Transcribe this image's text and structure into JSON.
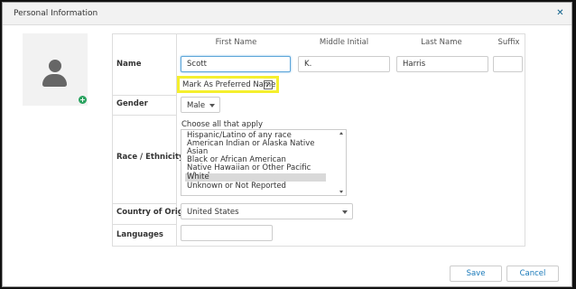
{
  "dialog": {
    "title": "Personal Information",
    "close_icon": "close-icon"
  },
  "avatar": {
    "icon": "user-silhouette-icon",
    "add_icon": "plus-icon"
  },
  "form": {
    "labels": {
      "name": "Name",
      "gender": "Gender",
      "race": "Race / Ethnicity",
      "country": "Country of Origin",
      "languages": "Languages"
    },
    "name": {
      "first_header": "First Name",
      "middle_header": "Middle Initial",
      "last_header": "Last Name",
      "suffix_header": "Suffix",
      "first_value": "Scott",
      "middle_value": "K.",
      "last_value": "Harris",
      "suffix_value": "",
      "preferred_label": "Mark As Preferred Name",
      "preferred_checked": "✓"
    },
    "gender": {
      "value": "Male"
    },
    "race": {
      "hint": "Choose all that apply",
      "options": [
        "Hispanic/Latino of any race",
        "American Indian or Alaska Native",
        "Asian",
        "Black or African American",
        "Native Hawaiian or Other Pacific Islander",
        "White",
        "Unknown or Not Reported"
      ],
      "selected": "White"
    },
    "country": {
      "value": "United States"
    },
    "languages": {
      "value": ""
    }
  },
  "footer": {
    "save": "Save",
    "cancel": "Cancel"
  },
  "colors": {
    "accent": "#1677b8",
    "highlight": "#f5ef2e",
    "add_icon": "#2aa360"
  }
}
